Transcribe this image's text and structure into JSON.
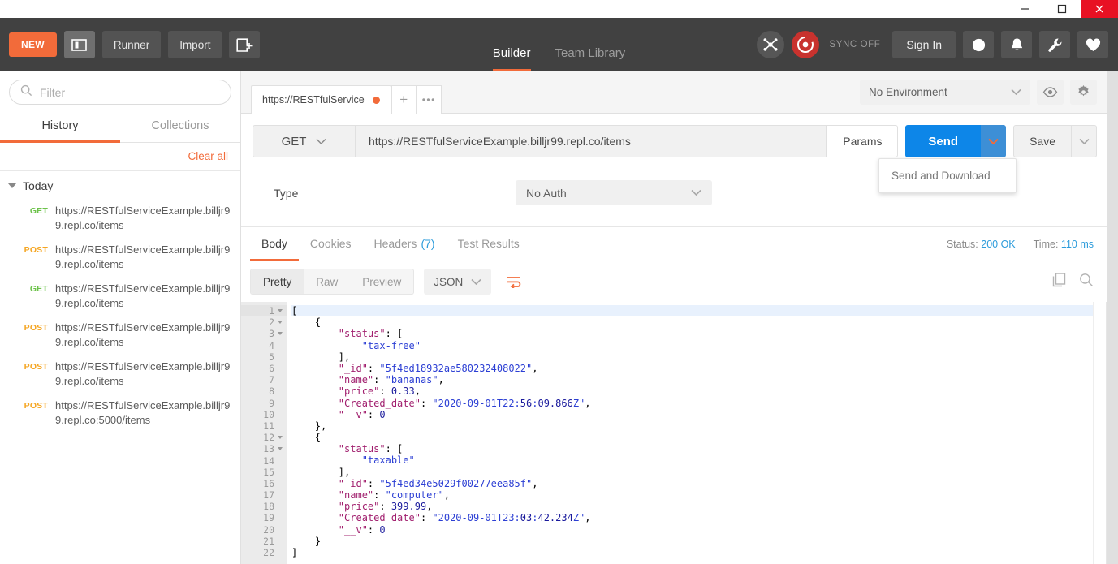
{
  "window": {
    "minimize": "minimize-icon",
    "maximize": "maximize-icon",
    "close": "close-icon"
  },
  "header": {
    "new_label": "NEW",
    "sidebar_toggle_icon": "sidebar-toggle-icon",
    "runner_label": "Runner",
    "import_label": "Import",
    "new_window_icon": "new-window-icon",
    "tabs": [
      {
        "label": "Builder",
        "active": true
      },
      {
        "label": "Team Library",
        "active": false
      }
    ],
    "interceptor_icon": "interceptor-icon",
    "sync_icon": "sync-icon",
    "sync_label": "SYNC OFF",
    "sign_in_label": "Sign In",
    "globe_icon": "globe-icon",
    "bell_icon": "bell-icon",
    "wrench_icon": "wrench-icon",
    "heart_icon": "heart-icon"
  },
  "sidebar": {
    "filter_placeholder": "Filter",
    "search_icon": "search-icon",
    "tabs": [
      {
        "label": "History",
        "active": true
      },
      {
        "label": "Collections",
        "active": false
      }
    ],
    "clear_all_label": "Clear all",
    "group_label": "Today",
    "history": [
      {
        "method": "GET",
        "url": "https://RESTfulServiceExample.billjr99.repl.co/items"
      },
      {
        "method": "POST",
        "url": "https://RESTfulServiceExample.billjr99.repl.co/items"
      },
      {
        "method": "GET",
        "url": "https://RESTfulServiceExample.billjr99.repl.co/items"
      },
      {
        "method": "POST",
        "url": "https://RESTfulServiceExample.billjr99.repl.co/items"
      },
      {
        "method": "POST",
        "url": "https://RESTfulServiceExample.billjr99.repl.co/items"
      },
      {
        "method": "POST",
        "url": "https://RESTfulServiceExample.billjr99.repl.co:5000/items"
      }
    ]
  },
  "request": {
    "tab_title": "https://RESTfulService",
    "tab_unsaved": true,
    "add_tab_icon": "plus-icon",
    "more_tabs_icon": "ellipsis-icon",
    "environment": "No Environment",
    "eye_icon": "eye-icon",
    "gear_icon": "gear-icon",
    "method": "GET",
    "url": "https://RESTfulServiceExample.billjr99.repl.co/items",
    "params_label": "Params",
    "send_label": "Send",
    "send_menu": [
      "Send and Download"
    ],
    "save_label": "Save",
    "auth_type_label": "Type",
    "auth_type_value": "No Auth"
  },
  "response": {
    "tabs": [
      {
        "label": "Body",
        "active": true,
        "count": ""
      },
      {
        "label": "Cookies",
        "active": false,
        "count": ""
      },
      {
        "label": "Headers",
        "active": false,
        "count": "(7)"
      },
      {
        "label": "Test Results",
        "active": false,
        "count": ""
      }
    ],
    "status_label": "Status:",
    "status_value": "200 OK",
    "time_label": "Time:",
    "time_value": "110 ms",
    "view_modes": [
      {
        "label": "Pretty",
        "active": true
      },
      {
        "label": "Raw",
        "active": false
      },
      {
        "label": "Preview",
        "active": false
      }
    ],
    "format": "JSON",
    "wrap_icon": "word-wrap-icon",
    "copy_icon": "copy-icon",
    "search_icon": "search-icon",
    "body_lines": [
      {
        "n": 1,
        "fold": true,
        "text": "["
      },
      {
        "n": 2,
        "fold": true,
        "text": "    {"
      },
      {
        "n": 3,
        "fold": true,
        "text": "        \"status\": ["
      },
      {
        "n": 4,
        "fold": false,
        "text": "            \"tax-free\""
      },
      {
        "n": 5,
        "fold": false,
        "text": "        ],"
      },
      {
        "n": 6,
        "fold": false,
        "text": "        \"_id\": \"5f4ed18932ae580232408022\","
      },
      {
        "n": 7,
        "fold": false,
        "text": "        \"name\": \"bananas\","
      },
      {
        "n": 8,
        "fold": false,
        "text": "        \"price\": 0.33,"
      },
      {
        "n": 9,
        "fold": false,
        "text": "        \"Created_date\": \"2020-09-01T22:56:09.866Z\","
      },
      {
        "n": 10,
        "fold": false,
        "text": "        \"__v\": 0"
      },
      {
        "n": 11,
        "fold": false,
        "text": "    },"
      },
      {
        "n": 12,
        "fold": true,
        "text": "    {"
      },
      {
        "n": 13,
        "fold": true,
        "text": "        \"status\": ["
      },
      {
        "n": 14,
        "fold": false,
        "text": "            \"taxable\""
      },
      {
        "n": 15,
        "fold": false,
        "text": "        ],"
      },
      {
        "n": 16,
        "fold": false,
        "text": "        \"_id\": \"5f4ed34e5029f00277eea85f\","
      },
      {
        "n": 17,
        "fold": false,
        "text": "        \"name\": \"computer\","
      },
      {
        "n": 18,
        "fold": false,
        "text": "        \"price\": 399.99,"
      },
      {
        "n": 19,
        "fold": false,
        "text": "        \"Created_date\": \"2020-09-01T23:03:42.234Z\","
      },
      {
        "n": 20,
        "fold": false,
        "text": "        \"__v\": 0"
      },
      {
        "n": 21,
        "fold": false,
        "text": "    }"
      },
      {
        "n": 22,
        "fold": false,
        "text": "]"
      }
    ]
  },
  "colors": {
    "accent_orange": "#f26b3a",
    "send_blue": "#0d86e8",
    "get_green": "#6cc24a",
    "post_orange": "#f5a623",
    "status_blue": "#2d9cdb",
    "header_dark": "#414141",
    "close_red": "#e81123"
  }
}
